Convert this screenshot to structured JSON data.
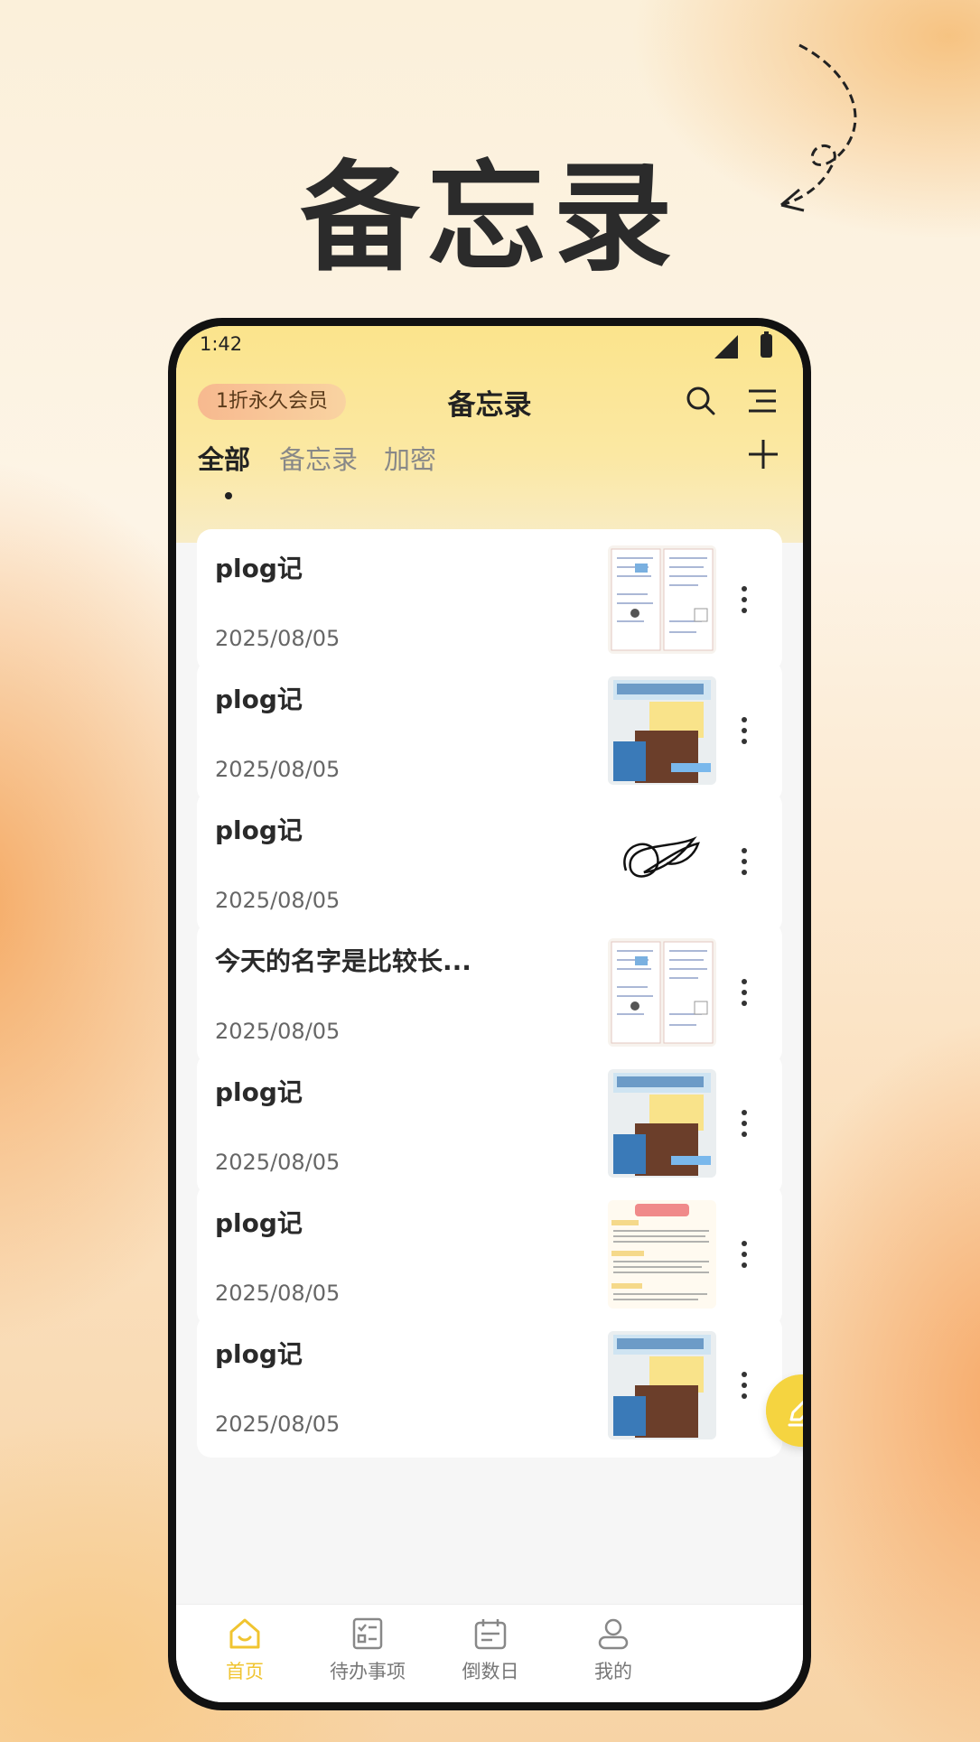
{
  "hero": {
    "title": "备忘录"
  },
  "status_bar": {
    "time": "1:42"
  },
  "header": {
    "vip_label": "1折永久会员",
    "title": "备忘录"
  },
  "tabs": [
    {
      "label": "全部",
      "active": true
    },
    {
      "label": "备忘录",
      "active": false
    },
    {
      "label": "加密",
      "active": false
    }
  ],
  "notes": [
    {
      "title": "plog记",
      "date": "2025/08/05",
      "thumbnail": "planner-page"
    },
    {
      "title": "plog记",
      "date": "2025/08/05",
      "thumbnail": "wish-list"
    },
    {
      "title": "plog记",
      "date": "2025/08/05",
      "thumbnail": "scribble-sketch"
    },
    {
      "title": "今天的名字是比较长...",
      "date": "2025/08/05",
      "thumbnail": "planner-page"
    },
    {
      "title": "plog记",
      "date": "2025/08/05",
      "thumbnail": "wish-list"
    },
    {
      "title": "plog记",
      "date": "2025/08/05",
      "thumbnail": "document-page"
    },
    {
      "title": "plog记",
      "date": "2025/08/05",
      "thumbnail": "wish-list"
    }
  ],
  "bottom_nav": [
    {
      "label": "首页",
      "icon": "home-icon",
      "active": true
    },
    {
      "label": "待办事项",
      "icon": "todo-list-icon",
      "active": false
    },
    {
      "label": "倒数日",
      "icon": "calendar-icon",
      "active": false
    },
    {
      "label": "我的",
      "icon": "profile-icon",
      "active": false
    }
  ],
  "colors": {
    "accent": "#f5d440",
    "header": "#fbe48c",
    "vip_badge": "#f7b98f",
    "active_nav": "#f0c430"
  }
}
